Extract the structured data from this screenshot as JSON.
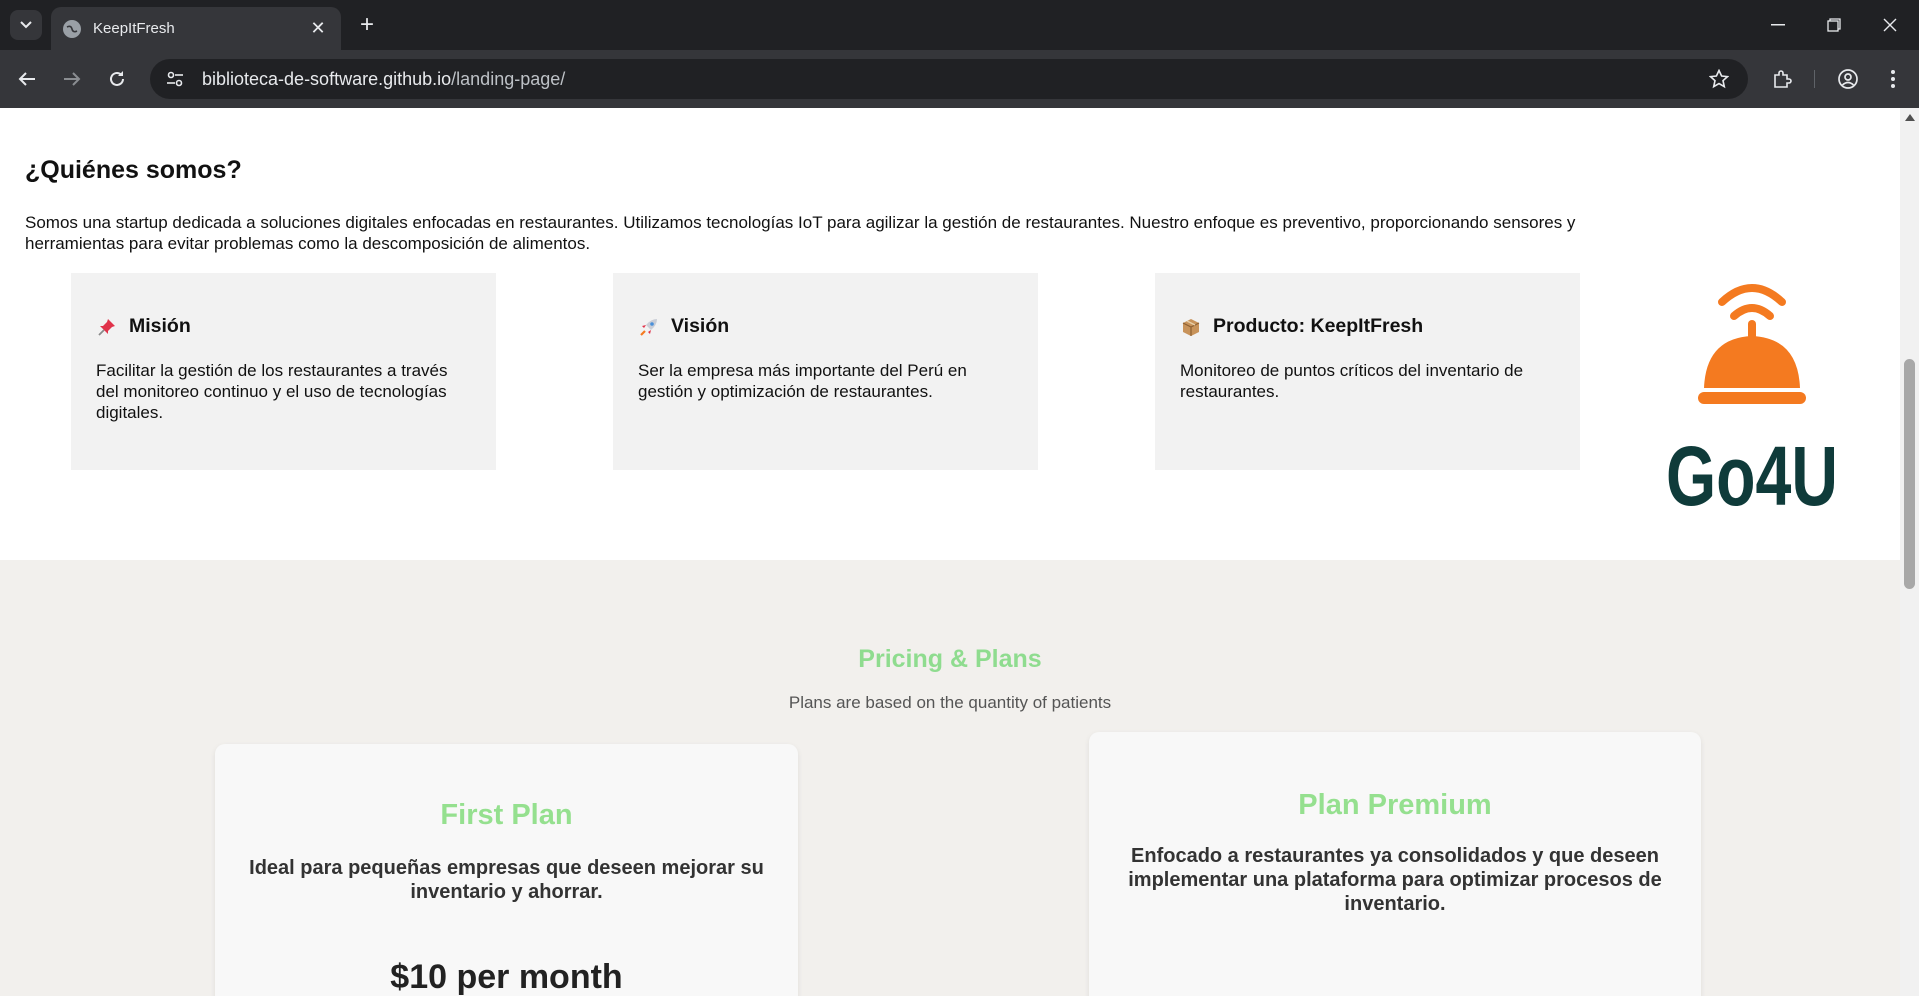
{
  "browser": {
    "tab_title": "KeepItFresh",
    "url_domain": "biblioteca-de-software.github.io",
    "url_path": "/landing-page/",
    "icons": [
      "tab-search-icon",
      "globe-icon",
      "close-icon",
      "plus-icon",
      "minimize-icon",
      "restore-icon",
      "window-close-icon",
      "back-arrow-icon",
      "forward-arrow-icon",
      "reload-icon",
      "site-info-icon",
      "star-icon",
      "extensions-icon",
      "profile-icon",
      "kebab-menu-icon"
    ],
    "new_tab_label": "+"
  },
  "about": {
    "title": "¿Quiénes somos?",
    "text": "Somos una startup dedicada a soluciones digitales enfocadas en restaurantes. Utilizamos tecnologías IoT para agilizar la gestión de restaurantes. Nuestro enfoque es preventivo, proporcionando sensores y herramientas para evitar problemas como la descomposición de alimentos.",
    "cards": [
      {
        "icon": "pushpin-icon",
        "title": "Misión",
        "text": "Facilitar la gestión de los restaurantes a través del monitoreo continuo y el uso de tecnologías digitales."
      },
      {
        "icon": "rocket-icon",
        "title": "Visión",
        "text": "Ser la empresa más importante del Perú en gestión y optimización de restaurantes."
      },
      {
        "icon": "package-icon",
        "title": "Producto: KeepItFresh",
        "text": "Monitoreo de puntos críticos del inventario de restaurantes."
      }
    ],
    "logo_text": "Go4U",
    "logo_colors": {
      "bell": "#f47a20",
      "text": "#0f3b3a"
    }
  },
  "pricing": {
    "title": "Pricing & Plans",
    "subtitle": "Plans are based on the quantity of patients",
    "plans": [
      {
        "name": "First Plan",
        "description": "Ideal para pequeñas empresas que deseen mejorar su inventario y ahorrar.",
        "price": "$10 per month"
      },
      {
        "name": "Plan Premium",
        "description": "Enfocado a restaurantes ya consolidados y que deseen implementar una plataforma para optimizar procesos de inventario."
      }
    ]
  }
}
